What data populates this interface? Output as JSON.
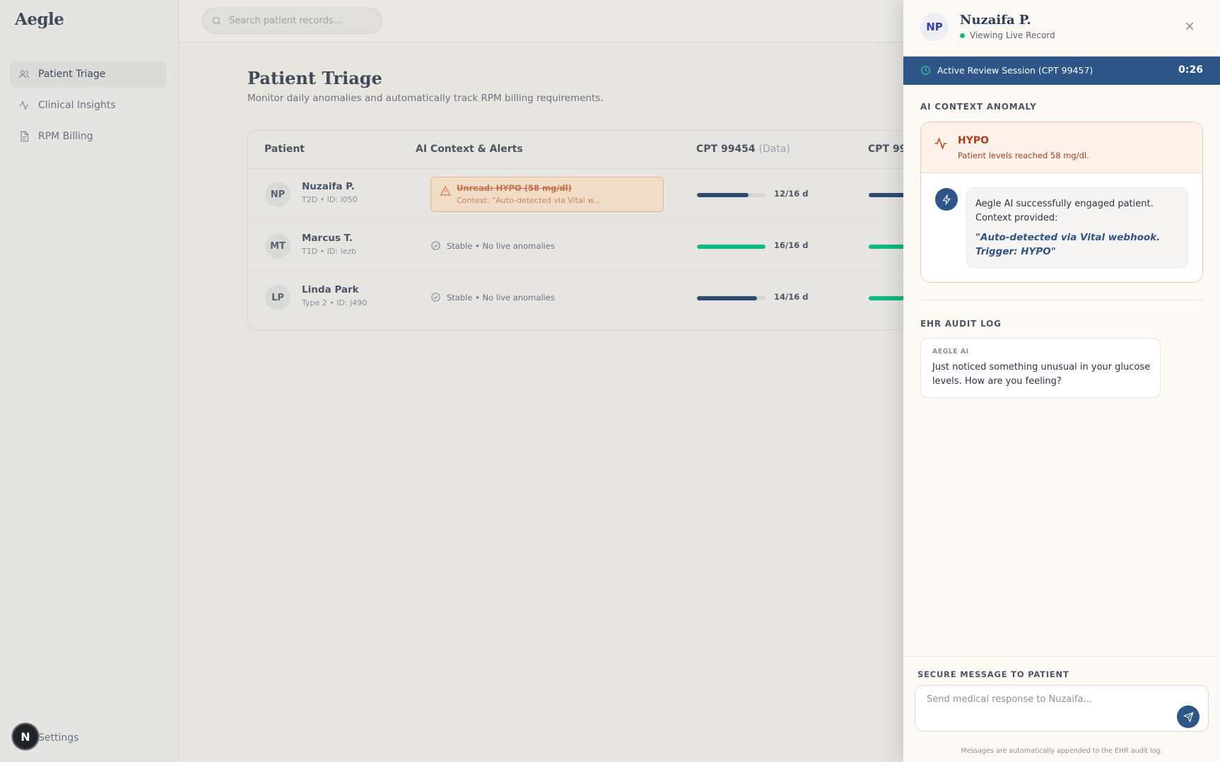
{
  "app": {
    "logo": "Aegle",
    "search_placeholder": "Search patient records...",
    "nav": [
      {
        "label": "Patient Triage",
        "icon": "users-icon",
        "active": true
      },
      {
        "label": "Clinical Insights",
        "icon": "activity-icon",
        "active": false
      },
      {
        "label": "RPM Billing",
        "icon": "document-icon",
        "active": false
      }
    ],
    "settings_label": "Settings",
    "user_initial": "N"
  },
  "triage": {
    "title": "Patient Triage",
    "subtitle": "Monitor daily anomalies and automatically track RPM billing requirements.",
    "columns": {
      "patient": "Patient",
      "alerts": "AI Context & Alerts",
      "cpt1": "CPT 99454",
      "cpt1_note": "(Data)",
      "cpt2": "CPT 99"
    },
    "rows": [
      {
        "initials": "NP",
        "name": "Nuzaifa P.",
        "meta": "T2D • ID: i050",
        "alert_title": "Unread: HYPO (58 mg/dl)",
        "alert_context": "Context: \"Auto-detected via Vital w...",
        "cpt_days": "12/16 d",
        "cpt_progress": 0.75,
        "cpt_color": "#2d4a73",
        "cpt2_color": "#2d4a73"
      },
      {
        "initials": "MT",
        "name": "Marcus T.",
        "meta": "T1D • ID: lezb",
        "stable_text": "Stable • No live anomalies",
        "cpt_days": "16/16 d",
        "cpt_progress": 1.0,
        "cpt_color": "#10b981",
        "cpt2_color": "#10b981"
      },
      {
        "initials": "LP",
        "name": "Linda Park",
        "meta": "Type 2 • ID: j490",
        "stable_text": "Stable • No live anomalies",
        "cpt_days": "14/16 d",
        "cpt_progress": 0.875,
        "cpt_color": "#2d4a73",
        "cpt2_color": "#10b981"
      }
    ]
  },
  "panel": {
    "initials": "NP",
    "name": "Nuzaifa P.",
    "status": "Viewing Live Record",
    "session_label": "Active Review Session (CPT 99457)",
    "session_timer": "0:26",
    "anomaly_section": "AI CONTEXT ANOMALY",
    "anomaly_title": "HYPO",
    "anomaly_sub": "Patient levels reached 58 mg/dl.",
    "ai_message": "Aegle AI successfully engaged patient. Context provided:",
    "ai_quote": "\"Auto-detected via Vital webhook. Trigger: HYPO\"",
    "audit_section": "EHR AUDIT LOG",
    "audit_author": "AEGLE AI",
    "audit_text": "Just noticed something unusual in your glucose levels. How are you feeling?",
    "composer_label": "SECURE MESSAGE TO PATIENT",
    "composer_placeholder": "Send medical response to Nuzaifa...",
    "composer_note": "Messages are automatically appended to the EHR audit log."
  },
  "colors": {
    "accent": "#2d5587",
    "alert": "#b43c1a",
    "success": "#10b981"
  }
}
